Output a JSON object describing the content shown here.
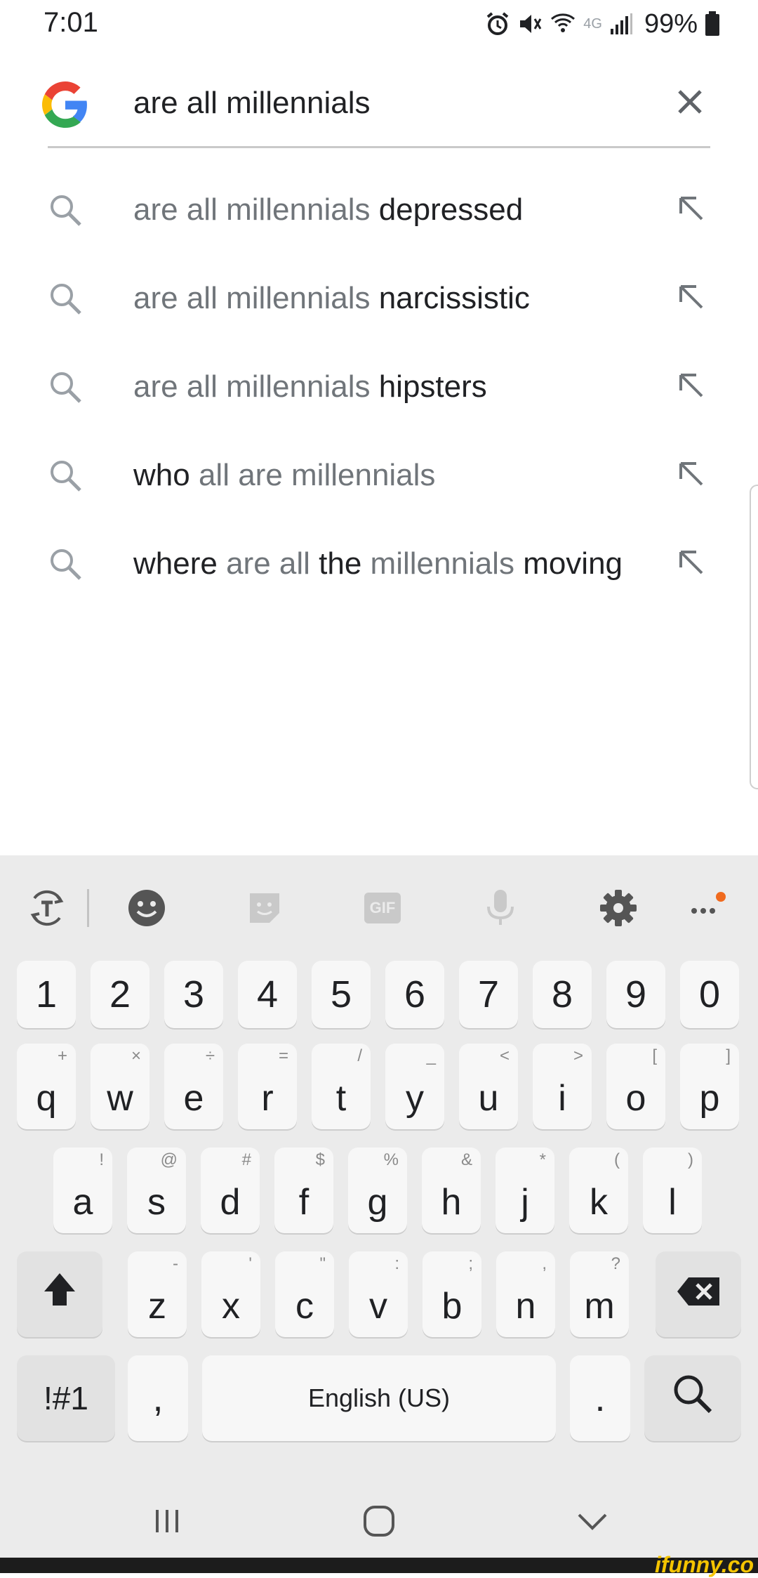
{
  "status_bar": {
    "time": "7:01",
    "network": "4G",
    "battery": "99%",
    "icons": [
      "alarm-icon",
      "mute-icon",
      "wifi-calling-icon",
      "signal-icon",
      "battery-icon"
    ]
  },
  "search": {
    "query": "are all millennials",
    "logo": "google-g-logo",
    "clear_icon": "close-icon"
  },
  "suggestions": [
    {
      "parts": [
        {
          "t": "are all millennials ",
          "s": "g"
        },
        {
          "t": "depressed",
          "s": "d"
        }
      ]
    },
    {
      "parts": [
        {
          "t": "are all millennials ",
          "s": "g"
        },
        {
          "t": "narcissistic",
          "s": "d"
        }
      ]
    },
    {
      "parts": [
        {
          "t": "are all millennials ",
          "s": "g"
        },
        {
          "t": "hipsters",
          "s": "d"
        }
      ]
    },
    {
      "parts": [
        {
          "t": "who ",
          "s": "d"
        },
        {
          "t": "all are millennials",
          "s": "g"
        }
      ]
    },
    {
      "parts": [
        {
          "t": "where ",
          "s": "d"
        },
        {
          "t": "are all ",
          "s": "g"
        },
        {
          "t": "the ",
          "s": "d"
        },
        {
          "t": "millennials ",
          "s": "g"
        },
        {
          "t": "moving",
          "s": "d"
        }
      ]
    }
  ],
  "keyboard": {
    "toolbar": [
      "text-translate-icon",
      "emoji-icon",
      "sticker-icon",
      "gif-icon",
      "microphone-icon",
      "settings-gear-icon",
      "more-options-icon"
    ],
    "gif_label": "GIF",
    "numbers": [
      "1",
      "2",
      "3",
      "4",
      "5",
      "6",
      "7",
      "8",
      "9",
      "0"
    ],
    "row1": [
      {
        "k": "q",
        "h": "+"
      },
      {
        "k": "w",
        "h": "×"
      },
      {
        "k": "e",
        "h": "÷"
      },
      {
        "k": "r",
        "h": "="
      },
      {
        "k": "t",
        "h": "/"
      },
      {
        "k": "y",
        "h": "_"
      },
      {
        "k": "u",
        "h": "<"
      },
      {
        "k": "i",
        "h": ">"
      },
      {
        "k": "o",
        "h": "["
      },
      {
        "k": "p",
        "h": "]"
      }
    ],
    "row2": [
      {
        "k": "a",
        "h": "!"
      },
      {
        "k": "s",
        "h": "@"
      },
      {
        "k": "d",
        "h": "#"
      },
      {
        "k": "f",
        "h": "$"
      },
      {
        "k": "g",
        "h": "%"
      },
      {
        "k": "h",
        "h": "&"
      },
      {
        "k": "j",
        "h": "*"
      },
      {
        "k": "k",
        "h": "("
      },
      {
        "k": "l",
        "h": ")"
      }
    ],
    "row3": [
      {
        "k": "z",
        "h": "-"
      },
      {
        "k": "x",
        "h": "'"
      },
      {
        "k": "c",
        "h": "\""
      },
      {
        "k": "v",
        "h": ":"
      },
      {
        "k": "b",
        "h": ";"
      },
      {
        "k": "n",
        "h": ","
      },
      {
        "k": "m",
        "h": "?"
      }
    ],
    "symbols_label": "!#1",
    "comma": ",",
    "space_label": "English (US)",
    "period": ".",
    "colors": {
      "accent_dot": "#f06a1e",
      "key": "#f7f7f7",
      "background": "#ebebeb"
    }
  },
  "nav_bar": [
    "recent-apps-icon",
    "home-icon",
    "hide-keyboard-icon"
  ],
  "watermark": "ifunny.co"
}
